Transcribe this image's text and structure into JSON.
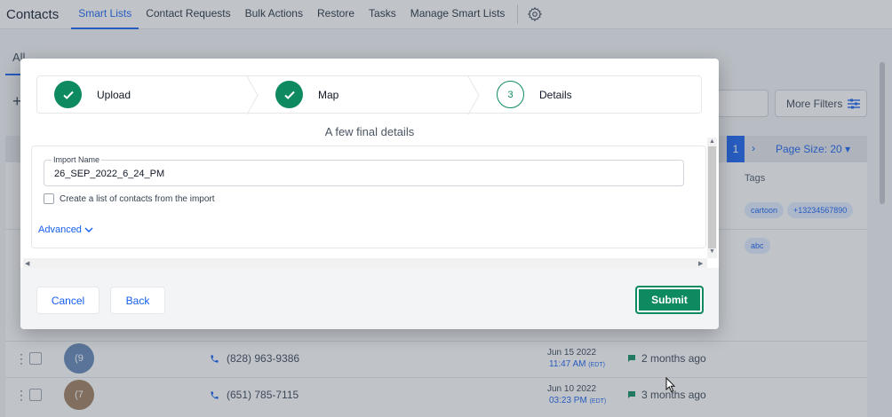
{
  "nav": {
    "brand": "Contacts",
    "items": [
      {
        "label": "Smart Lists",
        "active": true
      },
      {
        "label": "Contact Requests",
        "active": false
      },
      {
        "label": "Bulk Actions",
        "active": false
      },
      {
        "label": "Restore",
        "active": false
      },
      {
        "label": "Tasks",
        "active": false
      },
      {
        "label": "Manage Smart Lists",
        "active": false
      }
    ],
    "settings_icon": "gear-icon"
  },
  "page": {
    "tab_all": "All",
    "add_icon": "+",
    "more_filters": "More Filters",
    "pagination": {
      "current_page": "1",
      "next_icon": "›",
      "page_size": "Page Size: 20"
    },
    "tags_header": "Tags",
    "tags_row1": [
      "cartoon",
      "+13234567890"
    ],
    "tags_row2": [
      "abc"
    ],
    "rows": [
      {
        "avatar_text": "(9",
        "avatar_color": "#6384b5",
        "phone": "(828) 963-9386",
        "date": "Jun 15 2022",
        "time": "11:47 AM",
        "tz": "(EDT)",
        "activity": "2 months ago"
      },
      {
        "avatar_text": "(7",
        "avatar_color": "#a07c5b",
        "phone": "(651) 785-7115",
        "date": "Jun 10 2022",
        "time": "03:23 PM",
        "tz": "(EDT)",
        "activity": "3 months ago"
      }
    ]
  },
  "modal": {
    "steps": [
      {
        "label": "Upload",
        "status": "done",
        "icon": "check-icon"
      },
      {
        "label": "Map",
        "status": "done",
        "icon": "check-icon"
      },
      {
        "label": "Details",
        "status": "current",
        "number": "3"
      }
    ],
    "title": "A few final details",
    "import_name_label": "Import Name",
    "import_name_value": "26_SEP_2022_6_24_PM",
    "create_list_label": "Create a list of contacts from the import",
    "create_list_checked": false,
    "advanced_label": "Advanced",
    "cancel_label": "Cancel",
    "back_label": "Back",
    "submit_label": "Submit"
  },
  "colors": {
    "primary_blue": "#155eef",
    "success_green": "#0e8a60"
  }
}
